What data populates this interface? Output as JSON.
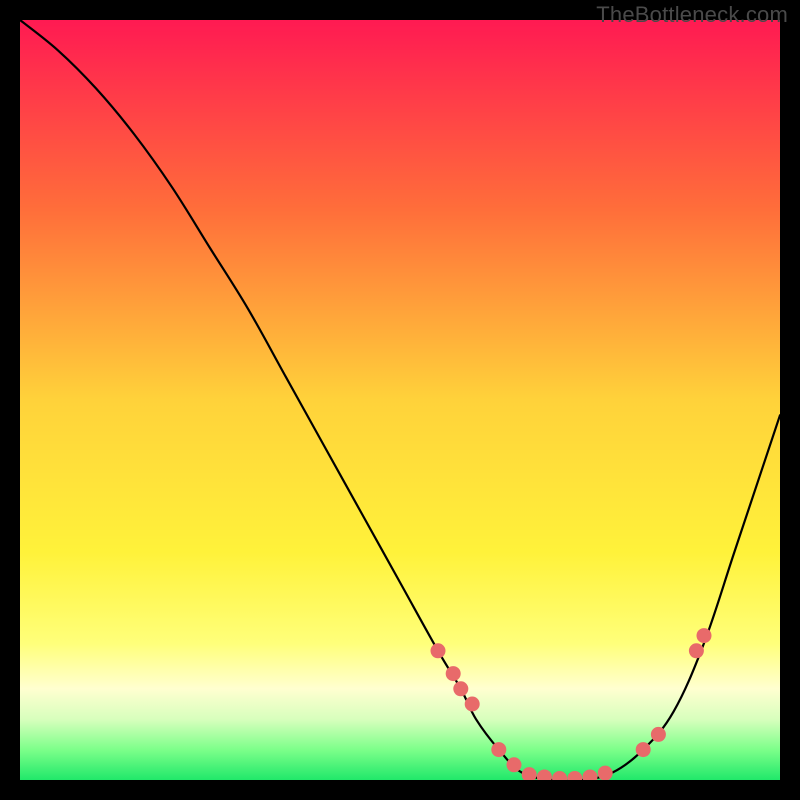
{
  "watermark": "TheBottleneck.com",
  "chart_data": {
    "type": "line",
    "title": "",
    "xlabel": "",
    "ylabel": "",
    "xlim": [
      0,
      100
    ],
    "ylim": [
      0,
      100
    ],
    "grid": false,
    "legend": false,
    "gradient_stops": [
      {
        "offset": 0,
        "color": "#ff1a52"
      },
      {
        "offset": 0.25,
        "color": "#ff6e3a"
      },
      {
        "offset": 0.5,
        "color": "#ffd23a"
      },
      {
        "offset": 0.7,
        "color": "#fff23a"
      },
      {
        "offset": 0.82,
        "color": "#ffff7a"
      },
      {
        "offset": 0.88,
        "color": "#ffffd0"
      },
      {
        "offset": 0.92,
        "color": "#d8ffbd"
      },
      {
        "offset": 0.96,
        "color": "#7dff8a"
      },
      {
        "offset": 1.0,
        "color": "#20e86a"
      }
    ],
    "series": [
      {
        "name": "curve",
        "x": [
          0,
          5,
          10,
          15,
          20,
          25,
          30,
          35,
          40,
          45,
          50,
          55,
          58,
          60,
          63,
          66,
          70,
          74,
          78,
          82,
          86,
          90,
          94,
          98,
          100
        ],
        "y": [
          100,
          96,
          91,
          85,
          78,
          70,
          62,
          53,
          44,
          35,
          26,
          17,
          12,
          8,
          4,
          1,
          0,
          0,
          1,
          4,
          9,
          18,
          30,
          42,
          48
        ]
      }
    ],
    "points": {
      "name": "markers",
      "color": "#e86a6a",
      "x": [
        55,
        57,
        58,
        59.5,
        63,
        65,
        67,
        69,
        71,
        73,
        75,
        77,
        82,
        84,
        89,
        90
      ],
      "y": [
        17,
        14,
        12,
        10,
        4,
        2,
        0.7,
        0.4,
        0.2,
        0.2,
        0.4,
        0.9,
        4,
        6,
        17,
        19
      ]
    }
  }
}
